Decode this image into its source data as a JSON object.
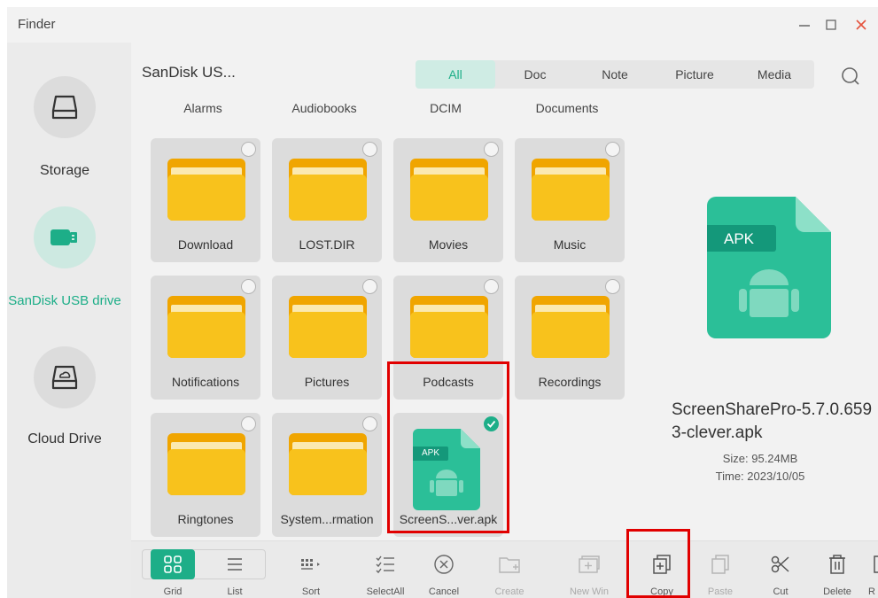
{
  "window": {
    "title": "Finder"
  },
  "sidebar": {
    "items": [
      {
        "label": "Storage",
        "icon": "hard-drive-icon",
        "active": false
      },
      {
        "label": "SanDisk USB drive",
        "icon": "usb-drive-icon",
        "active": true
      },
      {
        "label": "Cloud Drive",
        "icon": "cloud-drive-icon",
        "active": false
      }
    ]
  },
  "header": {
    "location": "SanDisk US...",
    "tabs": [
      "All",
      "Doc",
      "Note",
      "Picture",
      "Media"
    ],
    "active_tab": "All"
  },
  "grid": {
    "partial_row": [
      "Alarms",
      "Audiobooks",
      "DCIM",
      "Documents"
    ],
    "items": [
      {
        "name": "Download",
        "type": "folder"
      },
      {
        "name": "LOST.DIR",
        "type": "folder"
      },
      {
        "name": "Movies",
        "type": "folder"
      },
      {
        "name": "Music",
        "type": "folder"
      },
      {
        "name": "Notifications",
        "type": "folder"
      },
      {
        "name": "Pictures",
        "type": "folder"
      },
      {
        "name": "Podcasts",
        "type": "folder"
      },
      {
        "name": "Recordings",
        "type": "folder"
      },
      {
        "name": "Ringtones",
        "type": "folder"
      },
      {
        "name": "System...rmation",
        "type": "folder"
      },
      {
        "name": "ScreenS...ver.apk",
        "type": "apk",
        "badge": "APK",
        "selected": true
      }
    ]
  },
  "preview": {
    "badge": "APK",
    "filename": "ScreenSharePro-5.7.0.6593-clever.apk",
    "size": "Size: 95.24MB",
    "time": "Time: 2023/10/05"
  },
  "toolbar": {
    "buttons": [
      {
        "label": "Grid",
        "icon": "grid-icon",
        "active": true
      },
      {
        "label": "List",
        "icon": "list-icon"
      },
      {
        "label": "Sort",
        "icon": "sort-icon"
      },
      {
        "label": "SelectAll",
        "icon": "select-all-icon"
      },
      {
        "label": "Cancel",
        "icon": "cancel-icon"
      },
      {
        "label": "Create",
        "icon": "create-folder-icon",
        "disabled": true
      },
      {
        "label": "New Win",
        "icon": "new-window-icon",
        "disabled": true
      },
      {
        "label": "Copy",
        "icon": "copy-icon"
      },
      {
        "label": "Paste",
        "icon": "paste-icon",
        "disabled": true
      },
      {
        "label": "Cut",
        "icon": "cut-icon"
      },
      {
        "label": "Delete",
        "icon": "delete-icon"
      },
      {
        "label": "R",
        "icon": "rename-icon"
      }
    ]
  },
  "colors": {
    "accent": "#1dae88",
    "folder": "#f4b400",
    "highlight": "#e10000"
  }
}
